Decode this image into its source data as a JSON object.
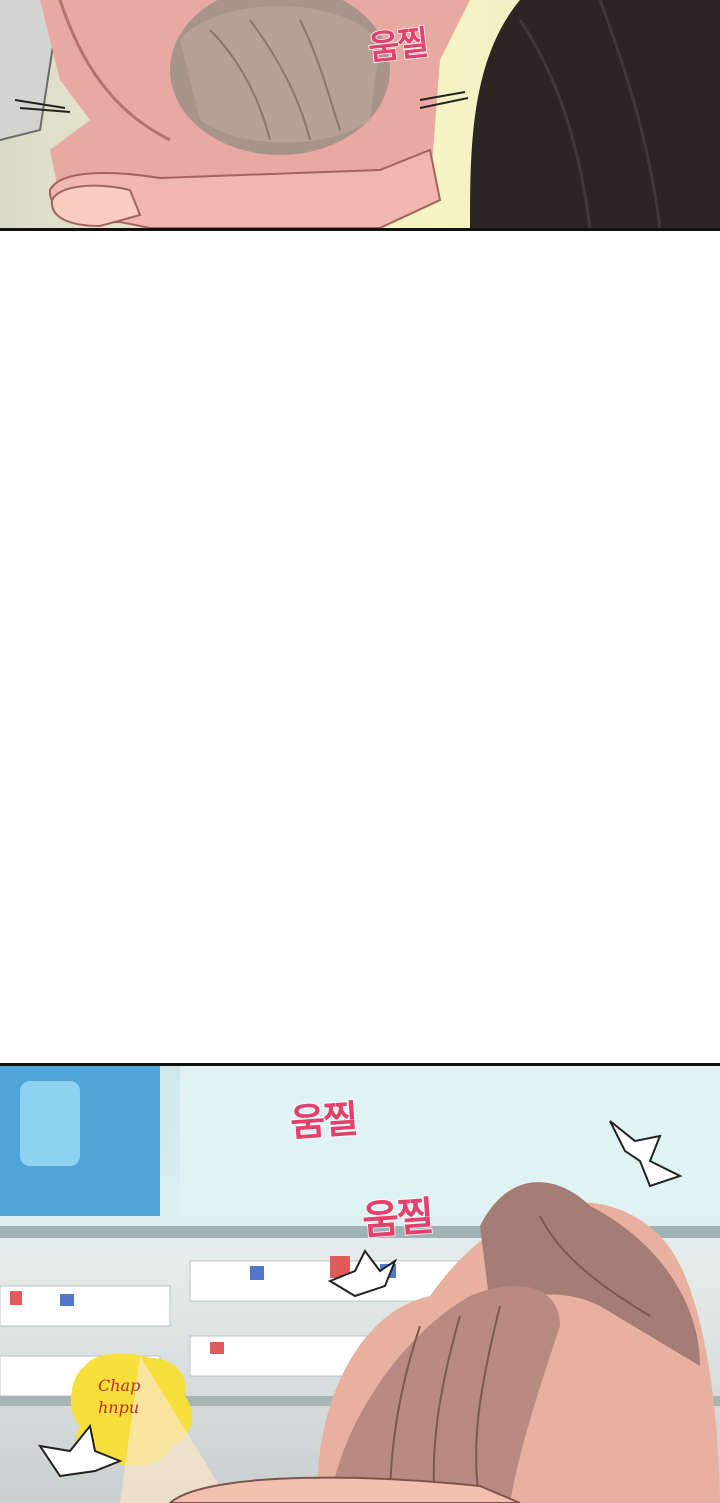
{
  "panels": {
    "top": {
      "sfx": "움찔"
    },
    "bottom": {
      "sfx_1": "움찔",
      "sfx_2": "움찔",
      "sign_line_1": "Chap",
      "sign_line_2": "hnpu"
    }
  },
  "colors": {
    "sfx": "#e2416b",
    "background": "#ffffff",
    "border": "#111111"
  }
}
